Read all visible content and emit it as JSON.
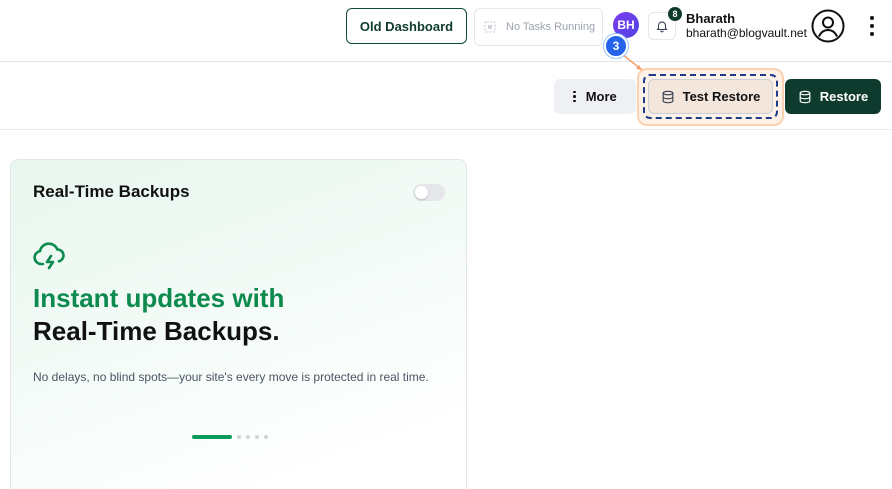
{
  "header": {
    "old_dashboard_label": "Old Dashboard",
    "tasks_label": "No Tasks Running",
    "avatar_initials": "BH",
    "notification_count": "8",
    "user_name": "Bharath",
    "user_email": "bharath@blogvault.net",
    "icons": [
      "tasks-icon",
      "bell-icon",
      "user-circle-icon",
      "kebab-menu-icon"
    ]
  },
  "tour": {
    "step_number": "3"
  },
  "actions": {
    "more_label": "More",
    "test_restore_label": "Test Restore",
    "restore_label": "Restore",
    "icons": [
      "vertical-dots-icon",
      "database-icon",
      "database-icon"
    ]
  },
  "card": {
    "title": "Real-Time Backups",
    "toggle_on": false,
    "headline_accent": "Instant updates with",
    "headline_main": "Real-Time Backups.",
    "description": "No delays, no blind spots—your site's every move is protected in real time.",
    "carousel_total": 5,
    "carousel_active": 1,
    "icon": "cloud-lightning-icon"
  },
  "colors": {
    "brand_dark": "#0f3b2f",
    "accent_green": "#0d8a4e",
    "step_blue": "#2563eb",
    "highlight_orange": "#fbd1b0"
  }
}
